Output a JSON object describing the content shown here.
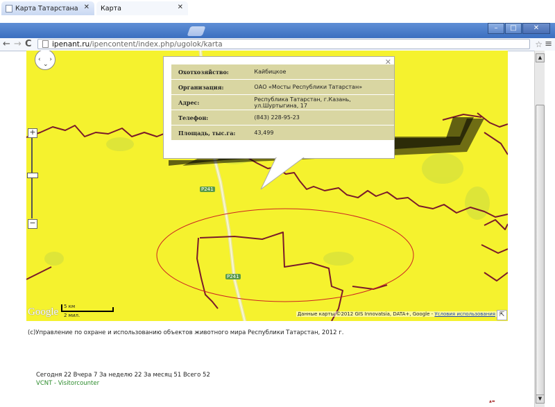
{
  "browser": {
    "tabs": [
      {
        "label": "Карта Татарстана",
        "active": false
      },
      {
        "label": "Карта",
        "active": true
      }
    ],
    "url_host": "ipenant.ru",
    "url_path": "/ipencontent/index.php/ugolok/karta",
    "window_buttons": [
      "minimize",
      "maximize",
      "close"
    ]
  },
  "map": {
    "road_labels": [
      "P241",
      "P241"
    ],
    "google_logo": "Google",
    "scale": {
      "km": "5 км",
      "mi": "2 мил."
    },
    "attribution": "Данные карты ©2012 GIS Innovatsia, DATA+, Google - ",
    "terms_link": "Условия использования",
    "colors": {
      "land": "#f5f22e",
      "border": "#7a1a2a",
      "ellipse": "#cc2222"
    },
    "info": {
      "rows": [
        {
          "label": "Охотхозяйство:",
          "value": "Кайбицкое"
        },
        {
          "label": "Организация:",
          "value": "ОАО «Мосты Республики Татарстан»"
        },
        {
          "label": "Адрес:",
          "value": "Республика Татарстан, г.Казань, ул.Шуртыгина, 17"
        },
        {
          "label": "Телефон:",
          "value": "(843) 228-95-23"
        },
        {
          "label": "Площадь, тыс.га:",
          "value": "43,499"
        }
      ]
    }
  },
  "footer": {
    "copyright": "(с)Управление по охране и использованию объектов животного мира Республики Татарстан, 2012 г.",
    "counter": "Сегодня 22 Вчера 7 За неделю 22 За месяц 51 Всего 52",
    "counter_link": "VCNT - Visitorcounter"
  }
}
